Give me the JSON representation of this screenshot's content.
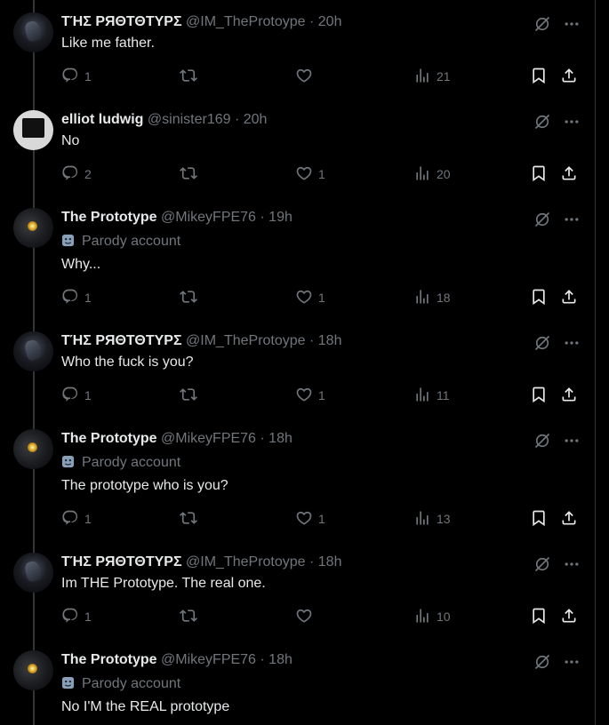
{
  "tweets": [
    {
      "name": "ΤΉΣ ΡЯΘΤΘΤΥΡΣ",
      "handle": "@IM_TheProtoype",
      "time": "20h",
      "text": "Like me father.",
      "parody": "",
      "replies": "1",
      "retweets": "",
      "likes": "",
      "views": "21",
      "avatar": "proto1"
    },
    {
      "name": "elliot ludwig",
      "handle": "@sinister169",
      "time": "20h",
      "text": "No",
      "parody": "",
      "replies": "2",
      "retweets": "",
      "likes": "1",
      "views": "20",
      "avatar": "elliot"
    },
    {
      "name": "The Prototype",
      "handle": "@MikeyFPE76",
      "time": "19h",
      "text": "Why...",
      "parody": "Parody account",
      "replies": "1",
      "retweets": "",
      "likes": "1",
      "views": "18",
      "avatar": "proto2"
    },
    {
      "name": "ΤΉΣ ΡЯΘΤΘΤΥΡΣ",
      "handle": "@IM_TheProtoype",
      "time": "18h",
      "text": "Who the fuck is you?",
      "parody": "",
      "replies": "1",
      "retweets": "",
      "likes": "1",
      "views": "11",
      "avatar": "proto1"
    },
    {
      "name": "The Prototype",
      "handle": "@MikeyFPE76",
      "time": "18h",
      "text": "The prototype who is you?",
      "parody": "Parody account",
      "replies": "1",
      "retweets": "",
      "likes": "1",
      "views": "13",
      "avatar": "proto2"
    },
    {
      "name": "ΤΉΣ ΡЯΘΤΘΤΥΡΣ",
      "handle": "@IM_TheProtoype",
      "time": "18h",
      "text": "Im THE Prototype. The real one.",
      "parody": "",
      "replies": "1",
      "retweets": "",
      "likes": "",
      "views": "10",
      "avatar": "proto1"
    },
    {
      "name": "The Prototype",
      "handle": "@MikeyFPE76",
      "time": "18h",
      "text": "No I'M the REAL prototype",
      "parody": "Parody account",
      "replies": "",
      "retweets": "",
      "likes": "",
      "views": "",
      "avatar": "proto2"
    }
  ],
  "icons": {
    "reply": "reply-icon",
    "retweet": "retweet-icon",
    "like": "heart-icon",
    "views": "views-icon",
    "bookmark": "bookmark-icon",
    "share": "share-icon",
    "grok": "grok-icon",
    "more": "more-icon",
    "parody": "parody-mask-icon"
  },
  "colors": {
    "background": "#000000",
    "text": "#e7e9ea",
    "muted": "#71767b",
    "divider": "#2f3336"
  }
}
